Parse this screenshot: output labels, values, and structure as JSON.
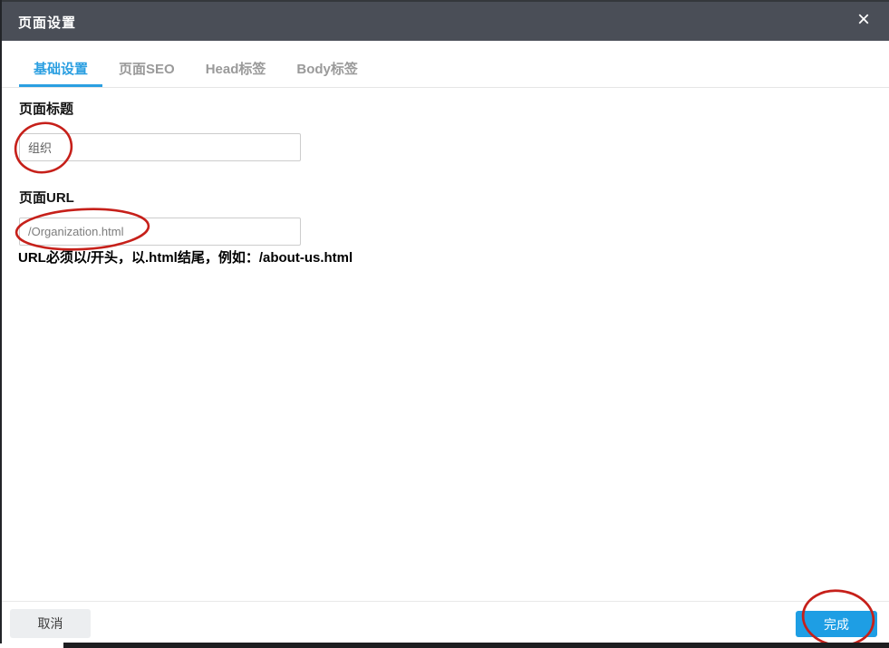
{
  "dialog": {
    "title": "页面设置",
    "close_glyph": "×"
  },
  "tabs": [
    {
      "label": "基础设置",
      "active": true
    },
    {
      "label": "页面SEO",
      "active": false
    },
    {
      "label": "Head标签",
      "active": false
    },
    {
      "label": "Body标签",
      "active": false
    }
  ],
  "form": {
    "title_field": {
      "label": "页面标题",
      "value": "组织"
    },
    "url_field": {
      "label": "页面URL",
      "value": "/Organization.html",
      "hint": "URL必须以/开头，以.html结尾，例如：/about-us.html"
    }
  },
  "footer": {
    "cancel_label": "取消",
    "done_label": "完成"
  },
  "colors": {
    "header_bg": "#4a4e57",
    "accent_blue": "#1e9ee4",
    "annotation_red": "#c6201a"
  },
  "annotations": [
    "circle-around-page-title-value",
    "circle-around-page-url-value",
    "circle-around-done-button"
  ]
}
